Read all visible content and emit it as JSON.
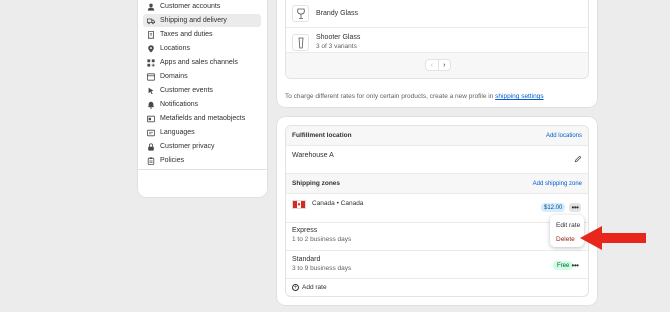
{
  "sidebar": {
    "items": [
      {
        "label": "Customer accounts",
        "icon": "person-icon",
        "active": false
      },
      {
        "label": "Shipping and delivery",
        "icon": "truck-icon",
        "active": true
      },
      {
        "label": "Taxes and duties",
        "icon": "receipt-icon",
        "active": false
      },
      {
        "label": "Locations",
        "icon": "location-pin-icon",
        "active": false
      },
      {
        "label": "Apps and sales channels",
        "icon": "apps-icon",
        "active": false
      },
      {
        "label": "Domains",
        "icon": "globe-icon",
        "active": false
      },
      {
        "label": "Customer events",
        "icon": "cursor-icon",
        "active": false
      },
      {
        "label": "Notifications",
        "icon": "bell-icon",
        "active": false
      },
      {
        "label": "Metafields and metaobjects",
        "icon": "metafield-icon",
        "active": false
      },
      {
        "label": "Languages",
        "icon": "language-icon",
        "active": false
      },
      {
        "label": "Customer privacy",
        "icon": "lock-icon",
        "active": false
      },
      {
        "label": "Policies",
        "icon": "clipboard-icon",
        "active": false
      }
    ]
  },
  "products": {
    "items": [
      {
        "name": "Brandy Glass",
        "sub": ""
      },
      {
        "name": "Shooter Glass",
        "sub": "3 of 3 variants"
      }
    ],
    "pager_prev": "‹",
    "pager_next": "›",
    "footer_text": "To charge different rates for only certain products, create a new profile in",
    "footer_link": "shipping settings"
  },
  "fulfillment": {
    "title": "Fulfillment location",
    "action": "Add locations",
    "location": "Warehouse A"
  },
  "zones": {
    "title": "Shipping zones",
    "action": "Add shipping zone",
    "zone_name": "Canada • Canada",
    "zone_price": "$12.00",
    "rates": [
      {
        "name": "Express",
        "sub": "1 to 2 business days",
        "price": ""
      },
      {
        "name": "Standard",
        "sub": "3 to 9 business days",
        "price": "Free"
      }
    ],
    "add_rate": "Add rate"
  },
  "popover": {
    "edit": "Edit rate",
    "delete": "Delete"
  },
  "colors": {
    "accent_link": "#005bd3",
    "delete_text": "#8e1f0b",
    "arrow": "#e8261b",
    "free_badge_bg": "#cdfee1",
    "price_badge_bg": "#d5ebff"
  }
}
